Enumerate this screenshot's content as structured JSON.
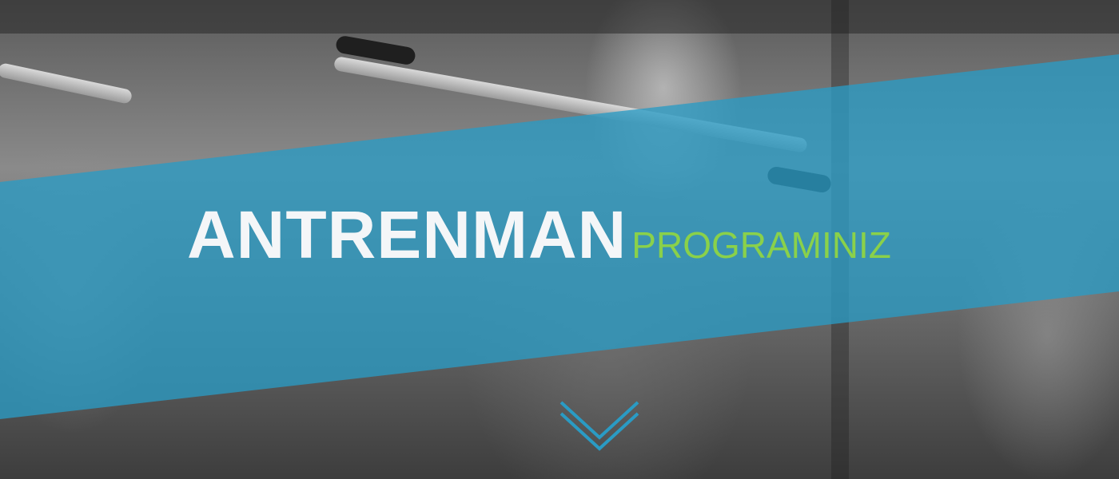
{
  "hero": {
    "title_main": "ANTRENMAN",
    "title_sub": "PROGRAMINIZ",
    "scroll_icon": "chevron-down-icon"
  },
  "colors": {
    "band": "#2A9BC4",
    "title_main": "#F4F6F8",
    "title_sub": "#8AD14A",
    "chevron": "#2A9BC4"
  }
}
